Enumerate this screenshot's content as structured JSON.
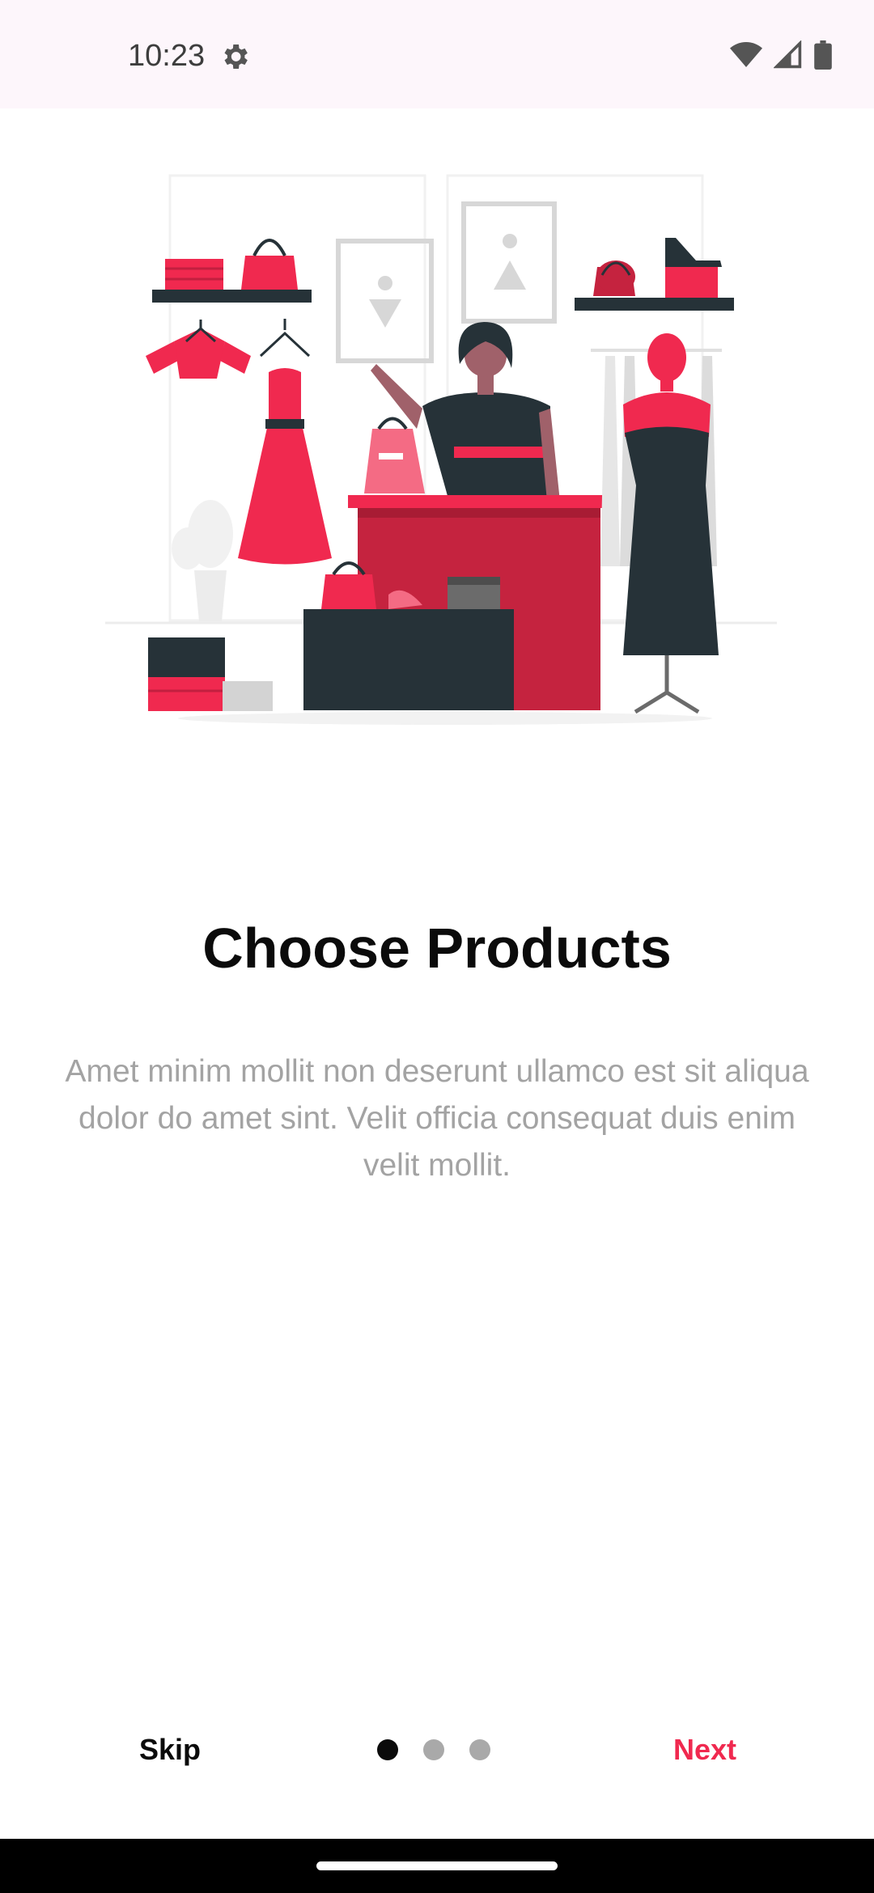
{
  "status_bar": {
    "time": "10:23"
  },
  "onboarding": {
    "title": "Choose Products",
    "description": "Amet minim mollit non deserunt ullamco est sit aliqua dolor do amet sint. Velit officia consequat duis enim velit mollit.",
    "current_page": 1,
    "total_pages": 3
  },
  "navigation": {
    "skip_label": "Skip",
    "next_label": "Next"
  },
  "colors": {
    "accent": "#f0294f",
    "dark": "#263238",
    "muted_text": "#a3a3a3",
    "status_bar_bg": "#fdf6fb"
  },
  "icons": [
    "settings-gear-icon",
    "wifi-icon",
    "cellular-signal-icon",
    "battery-icon"
  ]
}
